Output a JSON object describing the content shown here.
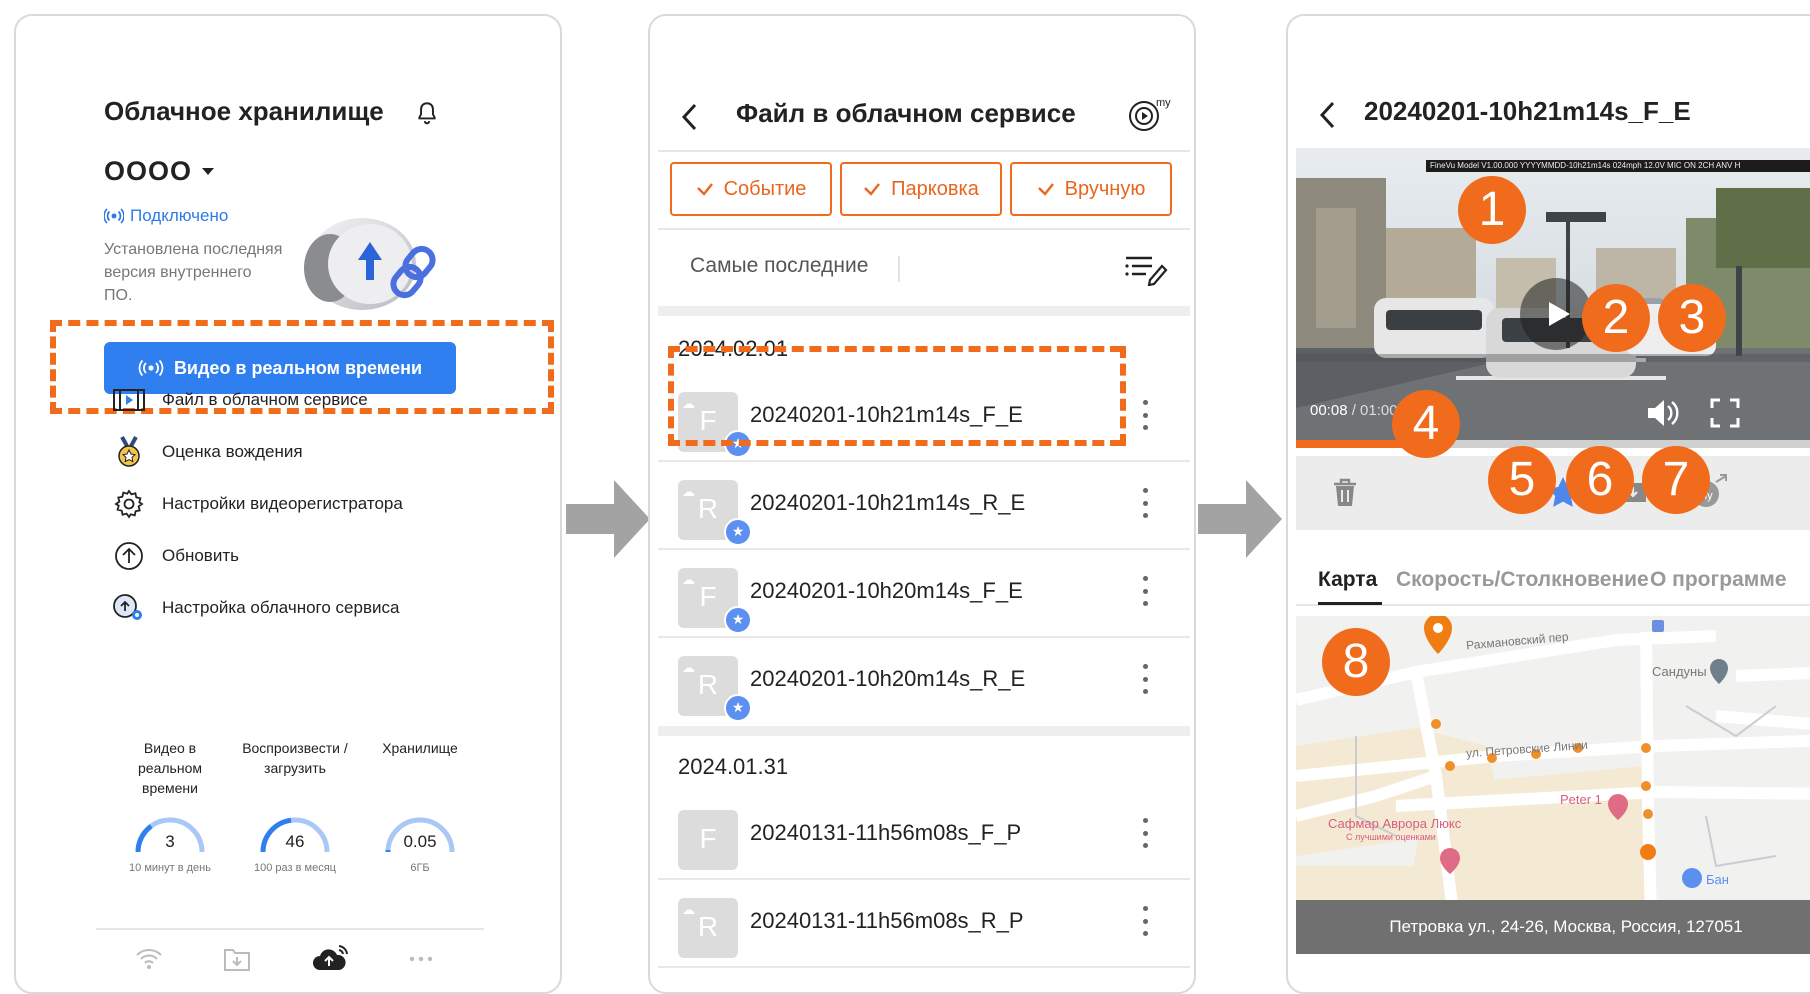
{
  "panel1": {
    "title": "Облачное хранилище",
    "device_name": "OOOO",
    "status": "Подключено",
    "firmware_note": "Установлена последняя версия внутреннего ПО.",
    "live_button": "Видео в реальном времени",
    "menu": [
      {
        "label": "Файл в облачном сервисе",
        "icon": "film-icon"
      },
      {
        "label": "Оценка вождения",
        "icon": "medal-icon"
      },
      {
        "label": "Настройки видеорегистратора",
        "icon": "gear-icon"
      },
      {
        "label": "Обновить",
        "icon": "upload-arrow-icon"
      },
      {
        "label": "Настройка облачного сервиса",
        "icon": "cloud-settings-icon"
      }
    ],
    "stats": [
      {
        "label": "Видео в реальном времени",
        "value": "3",
        "sub": "10 минут в день",
        "fraction": 0.3
      },
      {
        "label": "Воспроизвести /загрузить",
        "value": "46",
        "sub": "100 раз в месяц",
        "fraction": 0.46
      },
      {
        "label": "Хранилище",
        "value": "0.05",
        "sub": "6ГБ",
        "fraction": 0.01
      }
    ]
  },
  "panel2": {
    "title": "Файл в облачном сервисе",
    "filters": [
      "Событие",
      "Парковка",
      "Вручную"
    ],
    "sort": "Самые последние",
    "groups": [
      {
        "date": "2024.02.01",
        "files": [
          {
            "letter": "F",
            "name": "20240201-10h21m14s_F_E",
            "starred": true
          },
          {
            "letter": "R",
            "name": "20240201-10h21m14s_R_E",
            "starred": true
          },
          {
            "letter": "F",
            "name": "20240201-10h20m14s_F_E",
            "starred": true
          },
          {
            "letter": "R",
            "name": "20240201-10h20m14s_R_E",
            "starred": true
          }
        ]
      },
      {
        "date": "2024.01.31",
        "files": [
          {
            "letter": "F",
            "name": "20240131-11h56m08s_F_P",
            "starred": false
          },
          {
            "letter": "R",
            "name": "20240131-11h56m08s_R_P",
            "starred": false
          }
        ]
      }
    ]
  },
  "panel3": {
    "title": "20240201-10h21m14s_F_E",
    "overlay": "FineVu Model V1.00.000 YYYYMMDD-10h21m14s 024mph 12.0V MIC ON 2CH ANV H",
    "time_current": "00:08",
    "time_total": "/ 01:00",
    "progress": 0.23,
    "tabs": [
      "Карта",
      "Скорость/Столкновение",
      "О программе"
    ],
    "map": {
      "street1": "Рахмановский пер",
      "street2": "ул. Петровские Линии",
      "poi1": "Сандуны",
      "poi2": "Peter 1",
      "poi3": "Сафмар Аврора Люкс",
      "poi3_sub": "С лучшими оценками",
      "poi4": "Бан"
    },
    "address": "Петровка ул., 24-26, Москва, Россия, 127051",
    "callouts": [
      "1",
      "2",
      "3",
      "4",
      "5",
      "6",
      "7",
      "8"
    ]
  },
  "colors": {
    "accent": "#f06c1c",
    "blue": "#2f7ff0",
    "star": "#5b8ff0"
  }
}
